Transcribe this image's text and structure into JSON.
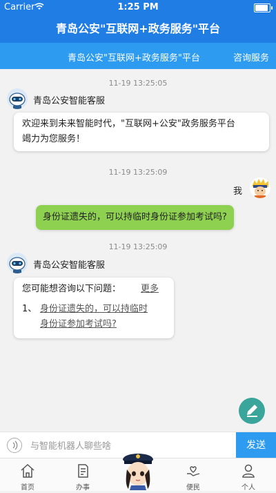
{
  "status_bar": {
    "carrier": "Carrier",
    "time": "1:25 PM"
  },
  "header": {
    "title": "青岛公安\"互联网+政务服务\"平台"
  },
  "subheader": {
    "title": "青岛公安\"互联网+政务服务\"平台",
    "link": "咨询服务"
  },
  "messages": [
    {
      "timestamp": "11-19 13:25:05",
      "sender": "青岛公安智能客服",
      "text_line1": "欢迎来到未来智能时代，\"互联网+公安\"政务服务平台",
      "text_line2": "竭力为您服务！"
    },
    {
      "timestamp": "11-19 13:25:09",
      "sender": "我",
      "text": "身份证遗失的，可以持临时身份证参加考试吗?"
    },
    {
      "timestamp": "11-19 13:25:09",
      "sender": "青岛公安智能客服",
      "prompt": "您可能想咨询以下问题：",
      "more": "更多",
      "suggestion_index": "1、",
      "suggestion_line1": "身份证遗失的，可以持临时",
      "suggestion_line2": "身份证参加考试吗?"
    }
  ],
  "input": {
    "placeholder": "与智能机器人聊些啥",
    "send_label": "发送"
  },
  "tabs": [
    {
      "label": "首页",
      "icon": "home-icon"
    },
    {
      "label": "办事",
      "icon": "document-icon"
    },
    {
      "label": "便民",
      "icon": "heart-hand-icon"
    },
    {
      "label": "个人",
      "icon": "person-icon"
    }
  ],
  "colors": {
    "primary": "#1f7de3",
    "secondary": "#2d9cf0",
    "user_bubble": "#8ed151",
    "fab": "#3aa59a"
  }
}
